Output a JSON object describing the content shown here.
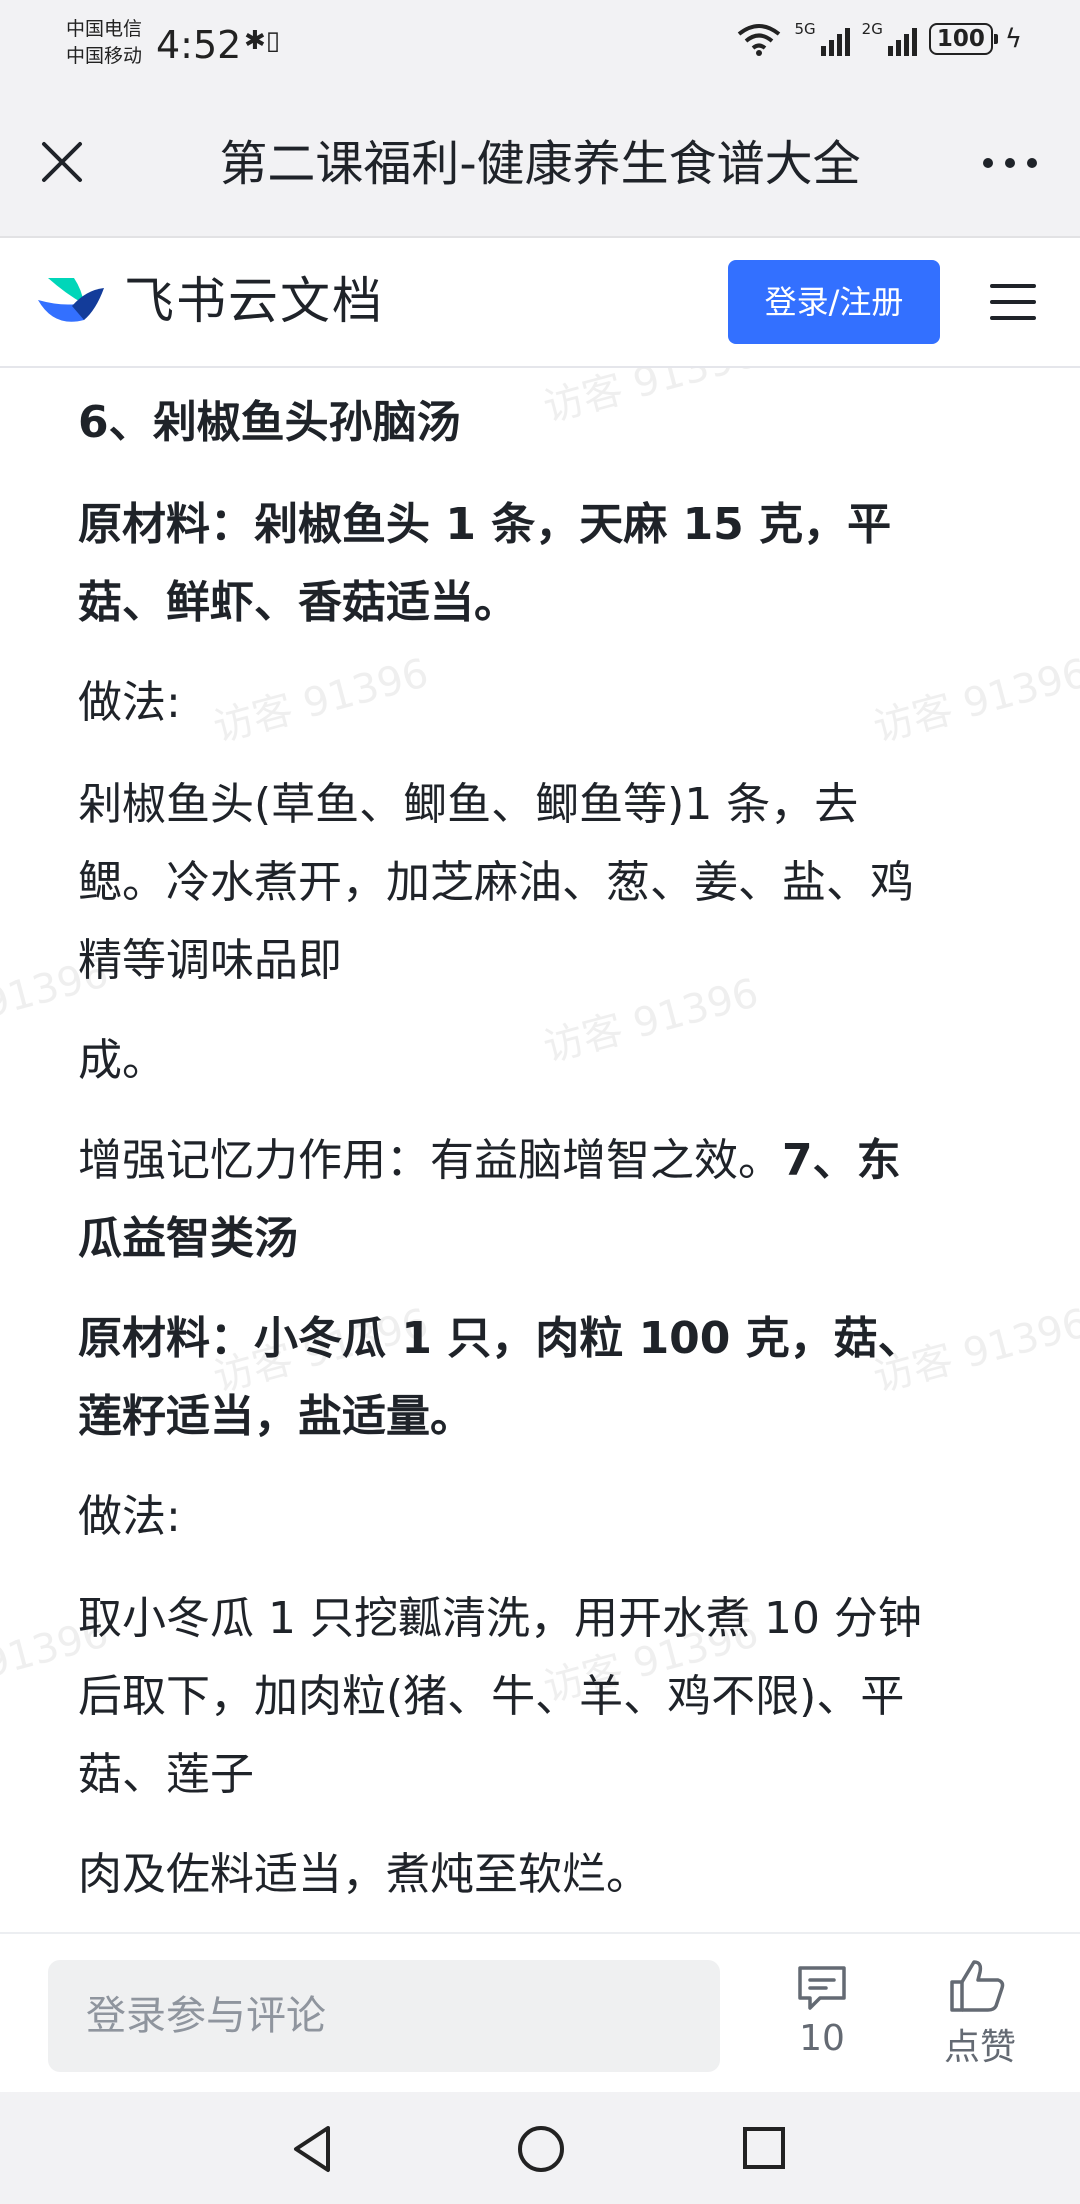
{
  "status_bar": {
    "carrier_1": "中国电信",
    "carrier_2": "中国移动",
    "time": "4:52",
    "network_1": "5G",
    "network_2": "2G",
    "battery": "100"
  },
  "title_bar": {
    "title": "第二课福利-健康养生食谱大全"
  },
  "header": {
    "brand": "飞书云文档",
    "login_label": "登录/注册"
  },
  "document": {
    "heading_6": "6、剁椒鱼头孙脑汤",
    "ingredients_6_line1": "原材料：剁椒鱼头 1 条，天麻 15 克，平",
    "ingredients_6_line2": "菇、鲜虾、香菇适当。",
    "method_label_1": "做法:",
    "method_6_line1": "剁椒鱼头(草鱼、鲫鱼、鲫鱼等)1 条，去",
    "method_6_line2": "鳃。冷水煮开，加芝麻油、葱、姜、盐、鸡",
    "method_6_line3": "精等调味品即",
    "method_6_line4": "成。",
    "effect_6": "增强记忆力作用：有益脑增智之效。",
    "heading_7_part1": "7、东",
    "heading_7_part2": "瓜益智类汤",
    "ingredients_7_line1": "原材料：小冬瓜 1 只，肉粒 100 克，菇、",
    "ingredients_7_line2": "莲籽适当，盐适量。",
    "method_label_2": "做法:",
    "method_7_line1": "取小冬瓜 1 只挖瓤清洗，用开水煮 10 分钟",
    "method_7_line2": "后取下，加肉粒(猪、牛、羊、鸡不限)、平",
    "method_7_line3": "菇、莲子",
    "method_7_line4": "肉及佐料适当，煮炖至软烂。",
    "watermark": "访客 91396"
  },
  "comment_bar": {
    "placeholder": "登录参与评论",
    "comment_count": "10",
    "like_label": "点赞"
  },
  "colors": {
    "accent": "#3370ff",
    "text": "#1f2329",
    "chrome_bg": "#f2f2f4"
  }
}
